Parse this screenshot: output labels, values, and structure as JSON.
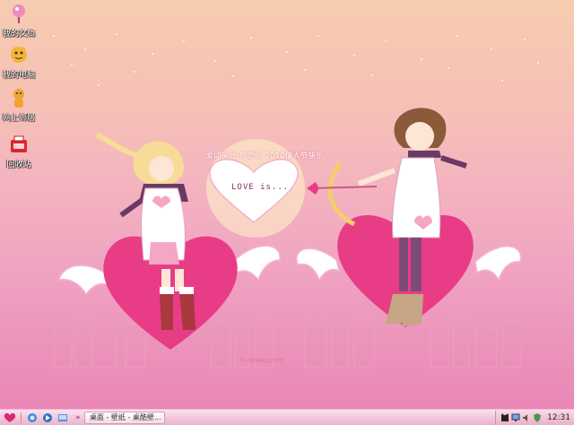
{
  "desktop": {
    "icons": [
      {
        "label": "我的文档",
        "icon": "my-documents-icon"
      },
      {
        "label": "我的电脑",
        "icon": "my-computer-icon"
      },
      {
        "label": "网上邻居",
        "icon": "network-places-icon"
      },
      {
        "label": "回收站",
        "icon": "recycle-bin-icon"
      }
    ]
  },
  "wallpaper": {
    "banner_text": "爱即关注·依恋你 2010情人节快乐",
    "heart_text": "LOVE is...",
    "site_text": "D desktx.com",
    "colors": {
      "sky_top": "#f7ccb0",
      "sky_bottom": "#e987b6",
      "heart": "#e83d86"
    }
  },
  "taskbar": {
    "start_icon": "start-heart-icon",
    "quicklaunch": [
      "ie-icon",
      "media-icon",
      "desktop-icon"
    ],
    "more_label": "»",
    "window_label": "桌面 - 壁纸 - 桌酷壁...",
    "tray_icons": [
      "cat-icon",
      "network-icon",
      "volume-icon",
      "shield-icon"
    ],
    "clock": "12:31"
  }
}
